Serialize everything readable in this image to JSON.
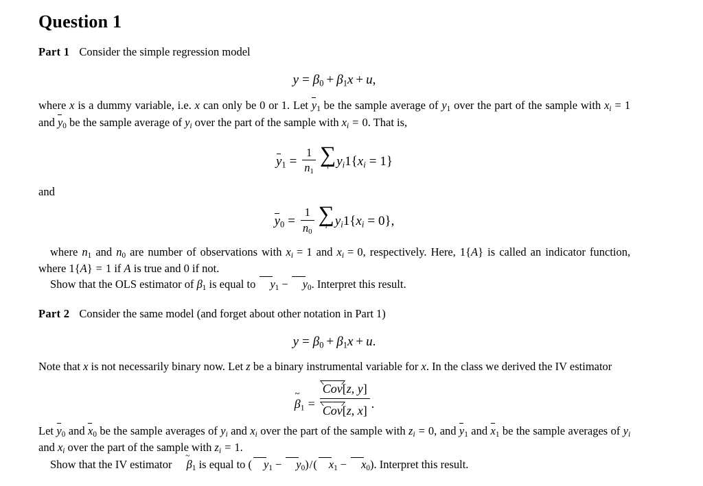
{
  "document": {
    "title": "Question 1"
  },
  "part1": {
    "label": "Part 1",
    "intro": "Consider the simple regression model",
    "equation_model": "y = β0 + β1x + u,",
    "para_where": "where x is a dummy variable, i.e. x can only be 0 or 1. Let ȳ₁ be the sample average of y₁ over the part of the sample with xᵢ = 1 and ȳ₀ be the sample average of yᵢ over the part of the sample with xᵢ = 0. That is,",
    "equation_ybar1": "ȳ₁ = (1/n₁) ∑ᵢ yᵢ 1{xᵢ = 1}",
    "connector_and": "and",
    "equation_ybar0": "ȳ₀ = (1/n₀) ∑ᵢ yᵢ 1{xᵢ = 0},",
    "para_indicator": "where n₁ and n₀ are number of observations with xᵢ = 1 and xᵢ = 0, respectively. Here, 1{A} is called an indicator function, where 1{A} = 1 if A is true and 0 if not.",
    "para_task": "Show that the OLS estimator of β₁ is equal to ȳ₁ − ȳ₀. Interpret this result."
  },
  "part2": {
    "label": "Part 2",
    "intro": "Consider the same model (and forget about other notation in Part 1)",
    "equation_model": "y = β0 + β1x + u.",
    "para_note": "Note that x is not necessarily binary now. Let z be a binary instrumental variable for x. In the class we derived the IV estimator",
    "equation_iv": "β̃₁ = Cov̂[z, y] / Cov̂[z, x] .",
    "para_let": "Let ȳ₀ and x̄₀ be the sample averages of yᵢ and xᵢ over the part of the sample with zᵢ = 0, and ȳ₁ and x̄₁ be the sample averages of yᵢ and xᵢ over the part of the sample with zᵢ = 1.",
    "para_task": "Show that the IV estimator β̃₁ is equal to (ȳ₁ − ȳ₀)/(x̄₁ − x̄₀). Interpret this result."
  },
  "tokens": {
    "where": "where",
    "x_var": "x",
    "is_dummy": "is a dummy variable, i.e.",
    "can_only": "can only be 0 or 1. Let",
    "be_sample_avg_of": "be the sample average of",
    "over_part_of": "over the part of",
    "the_sample_with": "the sample with",
    "and_word": "and",
    "be_sample_avg_of2": "be the sample average of",
    "over_part_of2": "over the part of the sample with",
    "that_is": ". That is,",
    "num_obs": "are number of observations with",
    "respectively": ", respectively. Here,",
    "called_an": "is called an",
    "indicator_fn": "indicator function, where",
    "if_true": "if",
    "is_true": "is true and 0 if not.",
    "show_that_ols": "Show that the OLS estimator of",
    "is_equal_to": "is equal to",
    "interpret": ". Interpret this result.",
    "note_that": "Note that",
    "not_binary": "is not necessarily binary now. Let",
    "binary_iv": "be a binary instrumental variable for",
    "in_the_class": ". In the class we",
    "derived_iv": "derived the IV estimator",
    "let_word": "Let",
    "sample_avgs_of": "be the sample averages of",
    "over_part_z0": "over the part of the sample with",
    "and_word2": "and",
    "be_word": "be",
    "the_sample_avgs": "the sample averages of",
    "show_that_iv": "Show that the IV estimator",
    "sum_symbol": "∑"
  }
}
